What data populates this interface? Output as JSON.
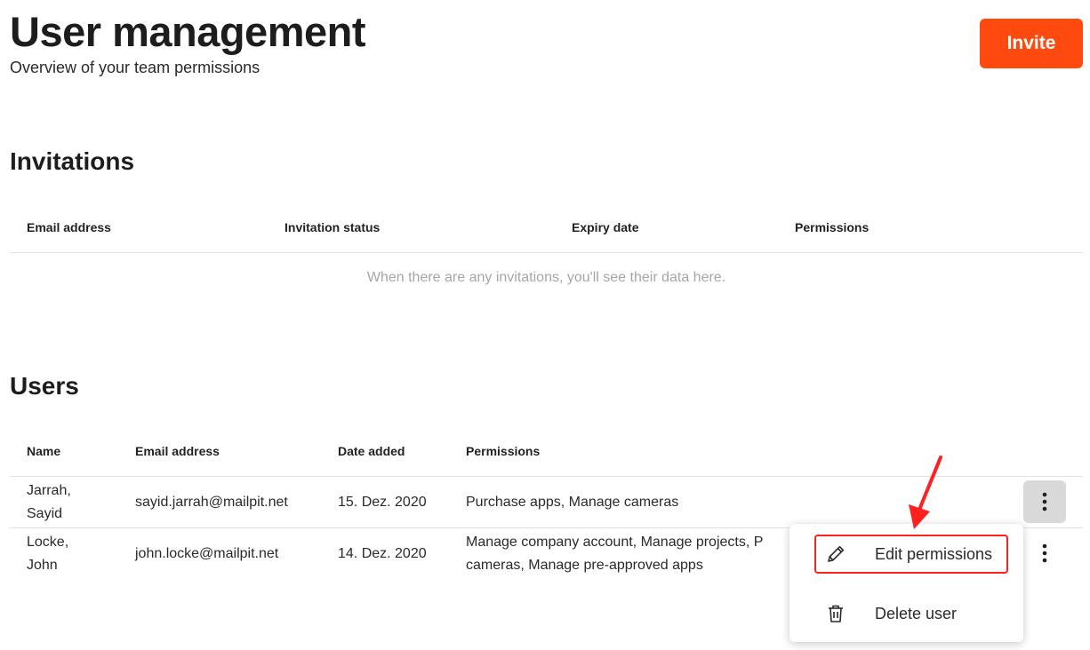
{
  "header": {
    "title": "User management",
    "subtitle": "Overview of your team permissions",
    "invite_label": "Invite"
  },
  "invitations": {
    "title": "Invitations",
    "columns": [
      "Email address",
      "Invitation status",
      "Expiry date",
      "Permissions"
    ],
    "empty_message": "When there are any invitations, you'll see their data here."
  },
  "users": {
    "title": "Users",
    "columns": [
      "Name",
      "Email address",
      "Date added",
      "Permissions"
    ],
    "rows": [
      {
        "name_line1": "Jarrah,",
        "name_line2": "Sayid",
        "email": "sayid.jarrah@mailpit.net",
        "date_added": "15. Dez. 2020",
        "permissions_line1": "Purchase apps, Manage cameras",
        "permissions_line2": ""
      },
      {
        "name_line1": "Locke,",
        "name_line2": "John",
        "email": "john.locke@mailpit.net",
        "date_added": "14. Dez. 2020",
        "permissions_line1": "Manage company account, Manage projects, P",
        "permissions_line2": "cameras, Manage pre-approved apps"
      }
    ]
  },
  "context_menu": {
    "items": [
      {
        "label": "Edit permissions",
        "icon": "pencil-icon"
      },
      {
        "label": "Delete user",
        "icon": "trash-icon"
      }
    ]
  },
  "colors": {
    "accent": "#ff4a0f",
    "annotation": "#ff2020"
  }
}
